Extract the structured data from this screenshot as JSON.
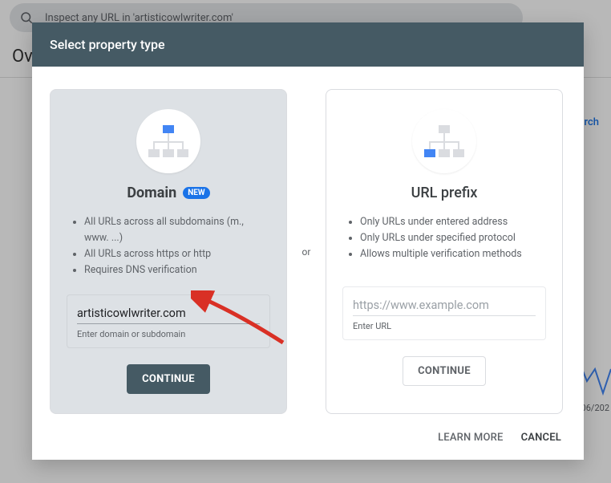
{
  "background": {
    "search_placeholder": "Inspect any URL in 'artisticowlwriter.com'",
    "overview": "Ove",
    "link_fragment": "earch",
    "date_label": "06/202"
  },
  "dialog": {
    "title": "Select property type",
    "or_label": "or",
    "learn_more": "LEARN MORE",
    "cancel": "CANCEL"
  },
  "domain_card": {
    "title": "Domain",
    "badge": "new",
    "bullets": [
      "All URLs across all subdomains (m., www. ...)",
      "All URLs across https or http",
      "Requires DNS verification"
    ],
    "input_value": "artisticowlwriter.com",
    "helper": "Enter domain or subdomain",
    "button": "CONTINUE"
  },
  "url_card": {
    "title": "URL prefix",
    "bullets": [
      "Only URLs under entered address",
      "Only URLs under specified protocol",
      "Allows multiple verification methods"
    ],
    "input_placeholder": "https://www.example.com",
    "helper": "Enter URL",
    "button": "CONTINUE"
  }
}
